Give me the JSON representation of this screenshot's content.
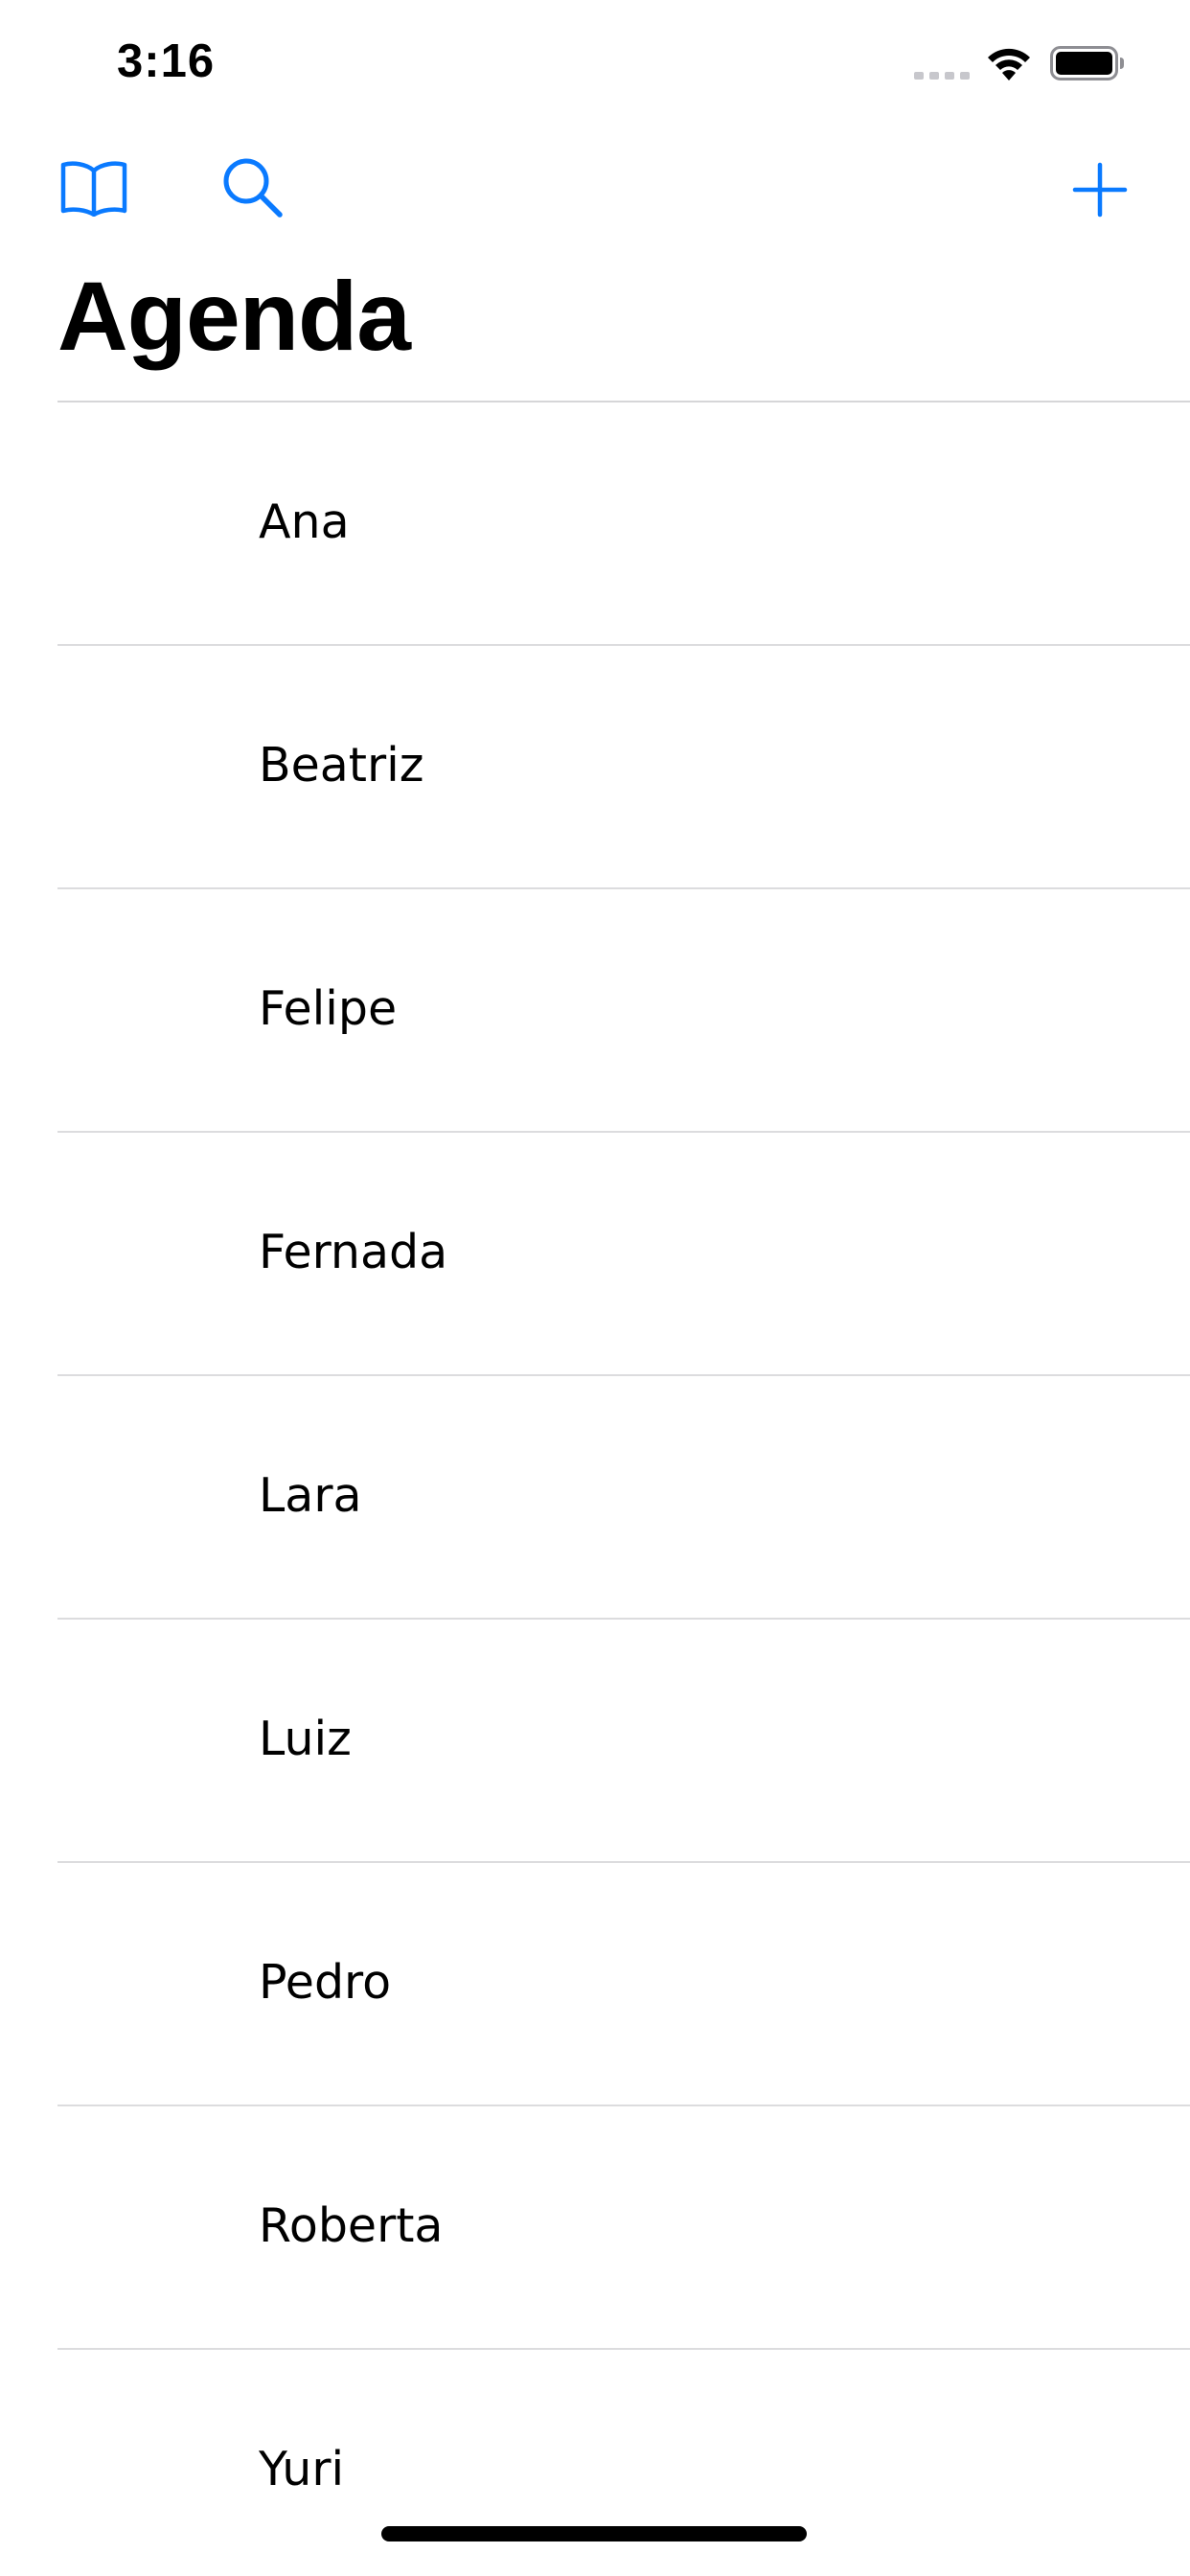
{
  "status_bar": {
    "time": "3:16"
  },
  "nav": {
    "title": "Agenda",
    "left_icons": [
      "book-icon",
      "search-icon"
    ],
    "right_icons": [
      "plus-icon"
    ],
    "accent_color": "#0a7aff"
  },
  "contacts": [
    {
      "name": "Ana"
    },
    {
      "name": "Beatriz"
    },
    {
      "name": "Felipe"
    },
    {
      "name": "Fernada"
    },
    {
      "name": "Lara"
    },
    {
      "name": "Luiz"
    },
    {
      "name": "Pedro"
    },
    {
      "name": "Roberta"
    },
    {
      "name": "Yuri"
    }
  ]
}
